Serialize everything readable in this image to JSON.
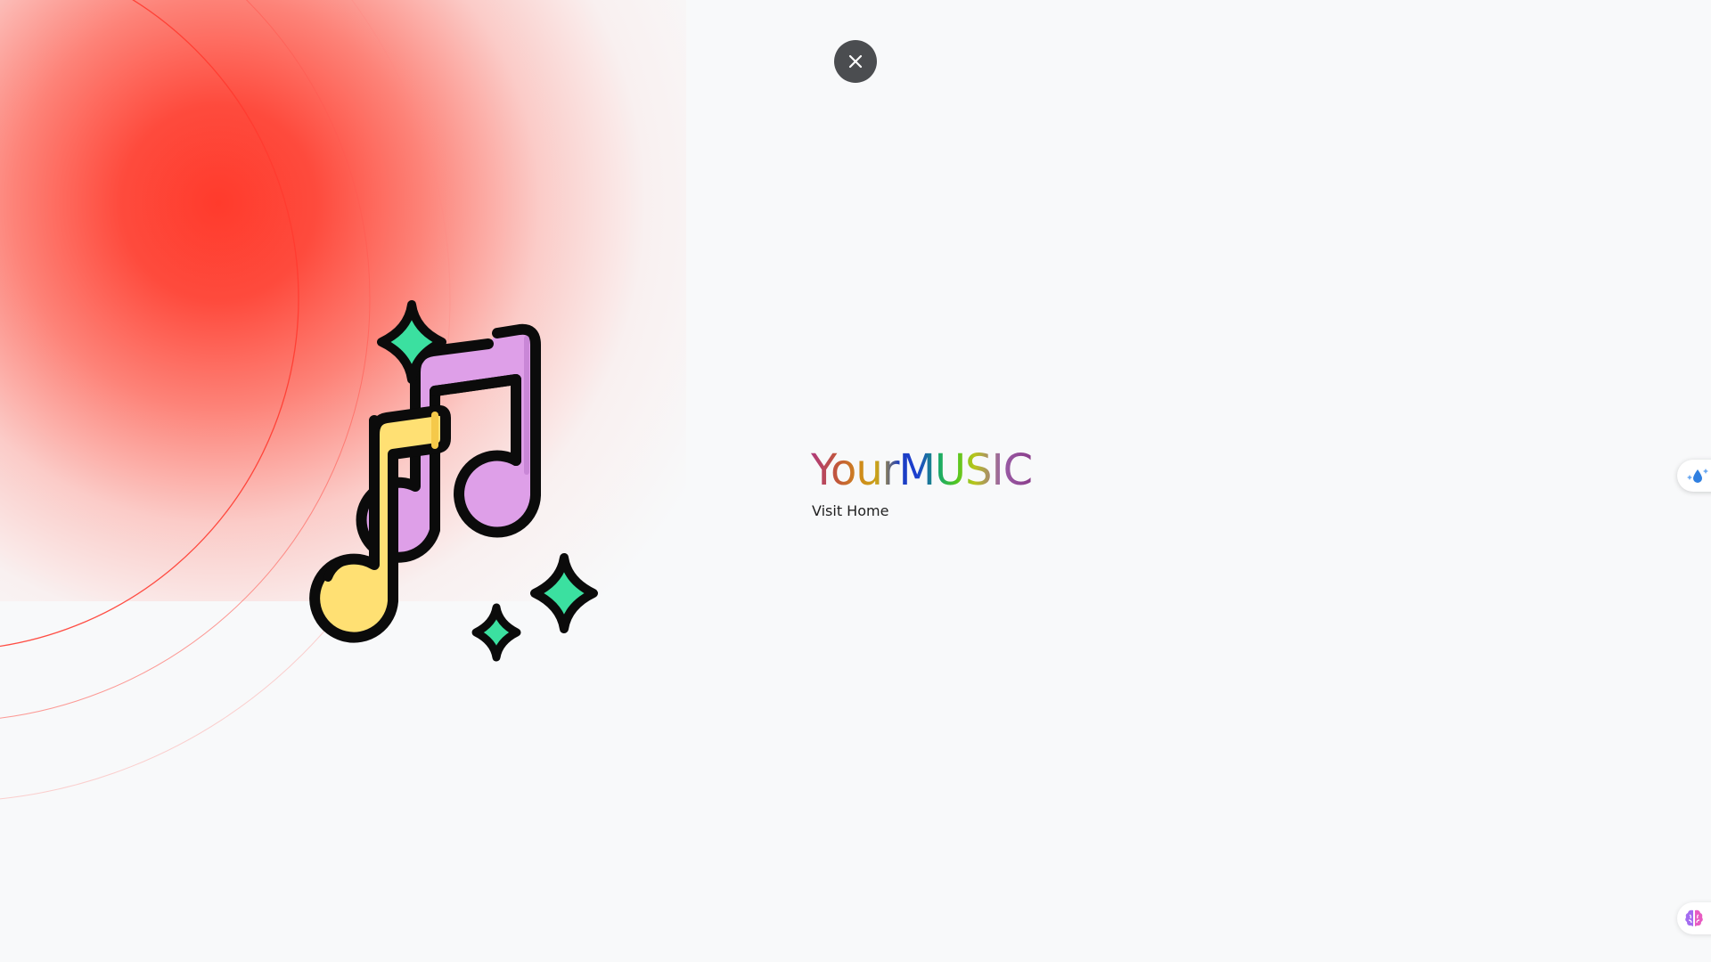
{
  "brand": {
    "title": "YourMUSIC",
    "link_label": "Visit Home"
  },
  "controls": {
    "close_icon": "close-icon"
  },
  "illustration": {
    "icon": "music-notes-icon",
    "colors": {
      "small_note": "#ffe073",
      "large_note": "#de9fe8",
      "sparkle": "#3be0a0",
      "outline": "#0b0b0b"
    }
  },
  "side_widgets": {
    "top_icon": "water-drop-sparkle-icon",
    "bottom_icon": "brain-icon"
  },
  "colors": {
    "glow": "#ff3b2f",
    "background": "#f8f9fa",
    "close_button": "#4b4d50"
  }
}
